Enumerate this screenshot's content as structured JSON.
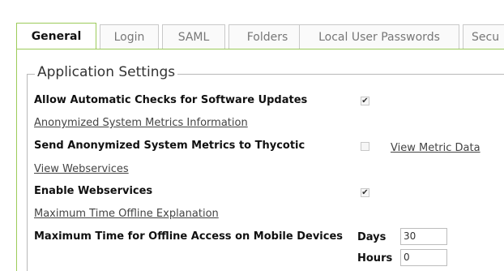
{
  "tabs": [
    {
      "label": "General",
      "active": true
    },
    {
      "label": "Login",
      "active": false
    },
    {
      "label": "SAML",
      "active": false
    },
    {
      "label": "Folders",
      "active": false
    },
    {
      "label": "Local User Passwords",
      "active": false
    },
    {
      "label": "Secu",
      "active": false
    }
  ],
  "section": {
    "title": "Application Settings"
  },
  "settings": {
    "auto_updates": {
      "label": "Allow Automatic Checks for Software Updates",
      "checked": true,
      "check_glyph": "✔"
    },
    "metrics_info_link": "Anonymized System Metrics Information",
    "send_metrics": {
      "label": "Send Anonymized System Metrics to Thycotic",
      "checked": false,
      "check_glyph": ""
    },
    "view_metric_link": "View Metric Data",
    "view_webservices_link": "View Webservices",
    "webservices": {
      "label": "Enable Webservices",
      "checked": true,
      "check_glyph": "✔"
    },
    "offline_explanation_link": "Maximum Time Offline Explanation",
    "offline_access": {
      "label": "Maximum Time for Offline Access on Mobile Devices",
      "days_label": "Days",
      "days_value": "30",
      "hours_label": "Hours",
      "hours_value": "0"
    }
  },
  "colors": {
    "accent_border": "#9ccb5a",
    "tab_border": "#c9c9c9"
  }
}
